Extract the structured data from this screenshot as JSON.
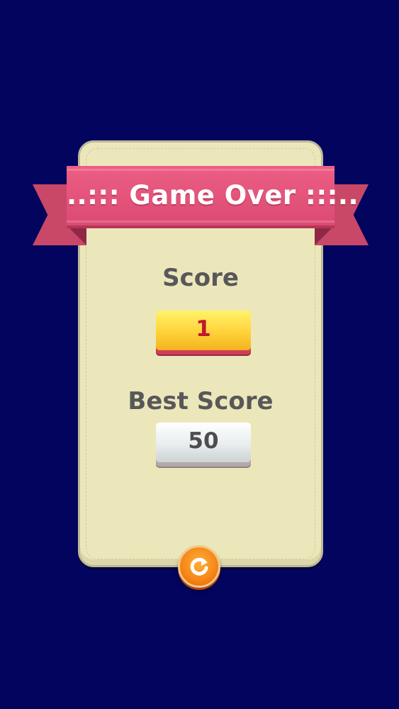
{
  "dialog": {
    "title": "..::: Game Over :::..",
    "score_label": "Score",
    "score_value": "1",
    "best_label": "Best Score",
    "best_value": "50"
  },
  "icons": {
    "replay": "replay-icon"
  },
  "colors": {
    "background": "#03045e",
    "panel": "#ece7bb",
    "ribbon": "#e35379",
    "score_box": "#ffd23a",
    "score_text": "#c0182d",
    "best_box": "#e8eded",
    "replay_button": "#f58516"
  }
}
